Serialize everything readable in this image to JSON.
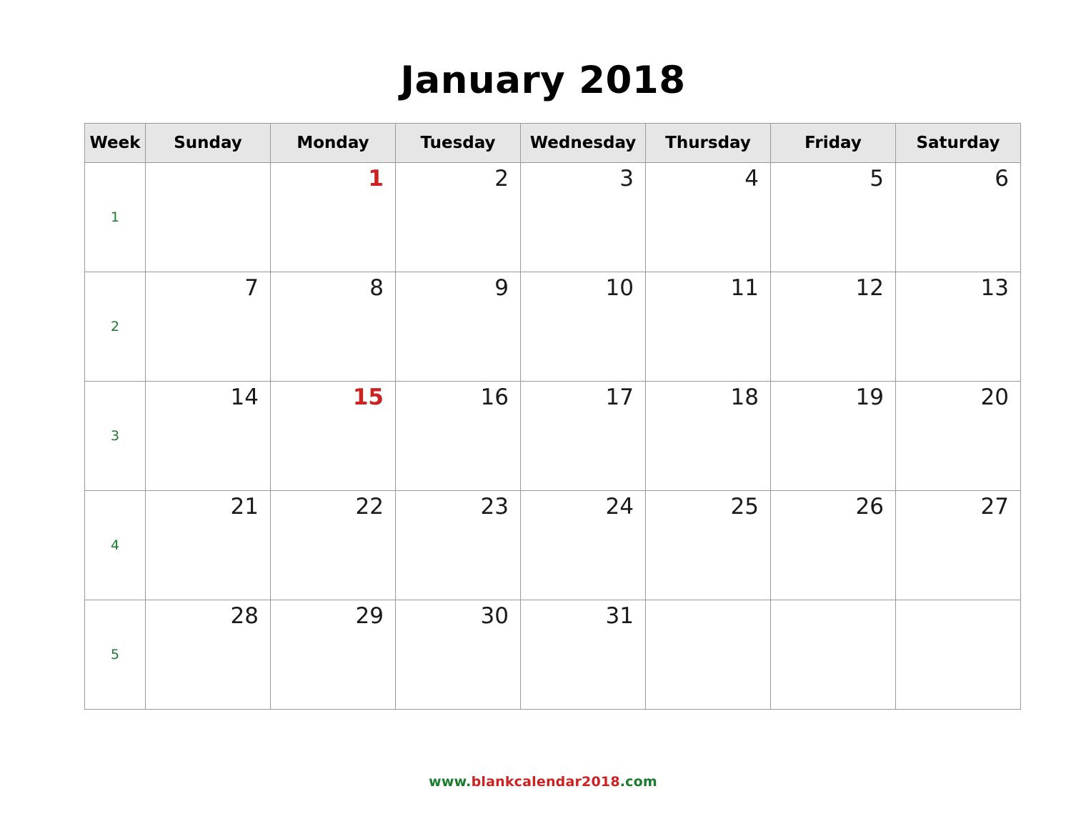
{
  "document": {
    "title": "January 2018",
    "month": "January",
    "year": "2018"
  },
  "colors": {
    "holiday": "#cc2222",
    "week_number": "#1a7a2e",
    "day_number": "#1a1a1a",
    "header_background": "#e6e6e6",
    "border": "#9a9a9a",
    "footer_green": "#1a7a2e",
    "footer_red": "#cc2222"
  },
  "table": {
    "headers": [
      "Week",
      "Sunday",
      "Monday",
      "Tuesday",
      "Wednesday",
      "Thursday",
      "Friday",
      "Saturday"
    ],
    "rows": [
      {
        "week": "1",
        "days": [
          {
            "label": "",
            "holiday": false,
            "empty": true
          },
          {
            "label": "1",
            "holiday": true,
            "empty": false
          },
          {
            "label": "2",
            "holiday": false,
            "empty": false
          },
          {
            "label": "3",
            "holiday": false,
            "empty": false
          },
          {
            "label": "4",
            "holiday": false,
            "empty": false
          },
          {
            "label": "5",
            "holiday": false,
            "empty": false
          },
          {
            "label": "6",
            "holiday": false,
            "empty": false
          }
        ]
      },
      {
        "week": "2",
        "days": [
          {
            "label": "7",
            "holiday": false,
            "empty": false
          },
          {
            "label": "8",
            "holiday": false,
            "empty": false
          },
          {
            "label": "9",
            "holiday": false,
            "empty": false
          },
          {
            "label": "10",
            "holiday": false,
            "empty": false
          },
          {
            "label": "11",
            "holiday": false,
            "empty": false
          },
          {
            "label": "12",
            "holiday": false,
            "empty": false
          },
          {
            "label": "13",
            "holiday": false,
            "empty": false
          }
        ]
      },
      {
        "week": "3",
        "days": [
          {
            "label": "14",
            "holiday": false,
            "empty": false
          },
          {
            "label": "15",
            "holiday": true,
            "empty": false
          },
          {
            "label": "16",
            "holiday": false,
            "empty": false
          },
          {
            "label": "17",
            "holiday": false,
            "empty": false
          },
          {
            "label": "18",
            "holiday": false,
            "empty": false
          },
          {
            "label": "19",
            "holiday": false,
            "empty": false
          },
          {
            "label": "20",
            "holiday": false,
            "empty": false
          }
        ]
      },
      {
        "week": "4",
        "days": [
          {
            "label": "21",
            "holiday": false,
            "empty": false
          },
          {
            "label": "22",
            "holiday": false,
            "empty": false
          },
          {
            "label": "23",
            "holiday": false,
            "empty": false
          },
          {
            "label": "24",
            "holiday": false,
            "empty": false
          },
          {
            "label": "25",
            "holiday": false,
            "empty": false
          },
          {
            "label": "26",
            "holiday": false,
            "empty": false
          },
          {
            "label": "27",
            "holiday": false,
            "empty": false
          }
        ]
      },
      {
        "week": "5",
        "days": [
          {
            "label": "28",
            "holiday": false,
            "empty": false
          },
          {
            "label": "29",
            "holiday": false,
            "empty": false
          },
          {
            "label": "30",
            "holiday": false,
            "empty": false
          },
          {
            "label": "31",
            "holiday": false,
            "empty": false
          },
          {
            "label": "",
            "holiday": false,
            "empty": true
          },
          {
            "label": "",
            "holiday": false,
            "empty": true
          },
          {
            "label": "",
            "holiday": false,
            "empty": true
          }
        ]
      }
    ]
  },
  "footer": {
    "part_www": "www.",
    "part_name": "blankcalendar2018",
    "part_tld": ".com",
    "full": "www.blankcalendar2018.com"
  }
}
